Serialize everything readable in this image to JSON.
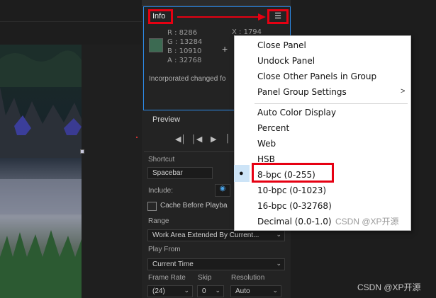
{
  "info_panel": {
    "tab_label": "Info",
    "menu_icon": "hamburger-icon",
    "color_swatch": "#3c6a52",
    "r": "R : 8286",
    "g": "G : 13284",
    "b": "B : 10910",
    "a": "A : 32768",
    "x": "X : 1794",
    "message": "Incorporated changed fo"
  },
  "preview_panel": {
    "title": "Preview",
    "shortcut_label": "Shortcut",
    "shortcut_value": "Spacebar",
    "include_label": "Include:",
    "cache_label": "Cache Before Playba",
    "range_label": "Range",
    "range_value": "Work Area Extended By Current...",
    "play_from_label": "Play From",
    "play_from_value": "Current Time",
    "frame_rate_label": "Frame Rate",
    "frame_rate_value": "(24)",
    "skip_label": "Skip",
    "skip_value": "0",
    "resolution_label": "Resolution",
    "resolution_value": "Auto"
  },
  "menu": {
    "items": [
      {
        "label": "Close Panel"
      },
      {
        "label": "Undock Panel"
      },
      {
        "label": "Close Other Panels in Group"
      },
      {
        "label": "Panel Group Settings",
        "submenu": ">"
      },
      {
        "label": "Auto Color Display"
      },
      {
        "label": "Percent"
      },
      {
        "label": "Web"
      },
      {
        "label": "HSB"
      },
      {
        "label": "8-bpc (0-255)",
        "selected": true
      },
      {
        "label": "10-bpc (0-1023)"
      },
      {
        "label": "16-bpc (0-32768)"
      },
      {
        "label": "Decimal (0.0-1.0)"
      }
    ]
  },
  "watermark": "CSDN @XP开源",
  "colors": {
    "highlight_red": "#e60012",
    "panel_focus_blue": "#2d8ceb",
    "selected_bg": "#cde4f7"
  }
}
